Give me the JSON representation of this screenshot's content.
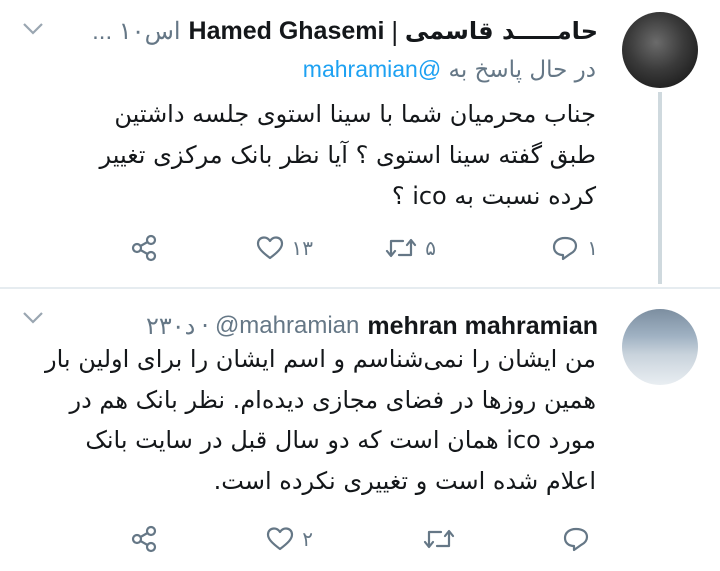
{
  "tweets": [
    {
      "display_name": "Hamed Ghasemi",
      "separator": "|",
      "display_name_fa": "حامـــــد قاسمی",
      "time": "... ۱۰اس",
      "reply_to_prefix": "در حال پاسخ به",
      "reply_to_handle": "@mahramian",
      "text_lines": [
        "جناب محرمیان شما با سینا استوی جلسه داشتین",
        "طبق گفته سینا استوی ؟ آیا نظر بانک مرکزی تغییر",
        "کرده نسبت به ico ؟"
      ],
      "actions": {
        "reply": "۱",
        "retweet": "۵",
        "like": "۱۳",
        "share": ""
      }
    },
    {
      "display_name": "mehran mahramian",
      "handle": "@mahramian",
      "time": "۲۳۰د",
      "text_lines": [
        "من ایشان را نمی‌شناسم و اسم ایشان را برای اولین بار",
        "همین روزها در فضای مجازی دیده‌ام. نظر بانک هم در",
        "مورد ico همان است که دو سال قبل در سایت بانک",
        "اعلام شده است و تغییری نکرده است."
      ],
      "actions": {
        "reply": "",
        "retweet": "",
        "like": "۲",
        "share": ""
      }
    }
  ],
  "colors": {
    "text": "#14171a",
    "secondary": "#657786",
    "link": "#1da1f2",
    "thread_line": "#cfd9de"
  }
}
